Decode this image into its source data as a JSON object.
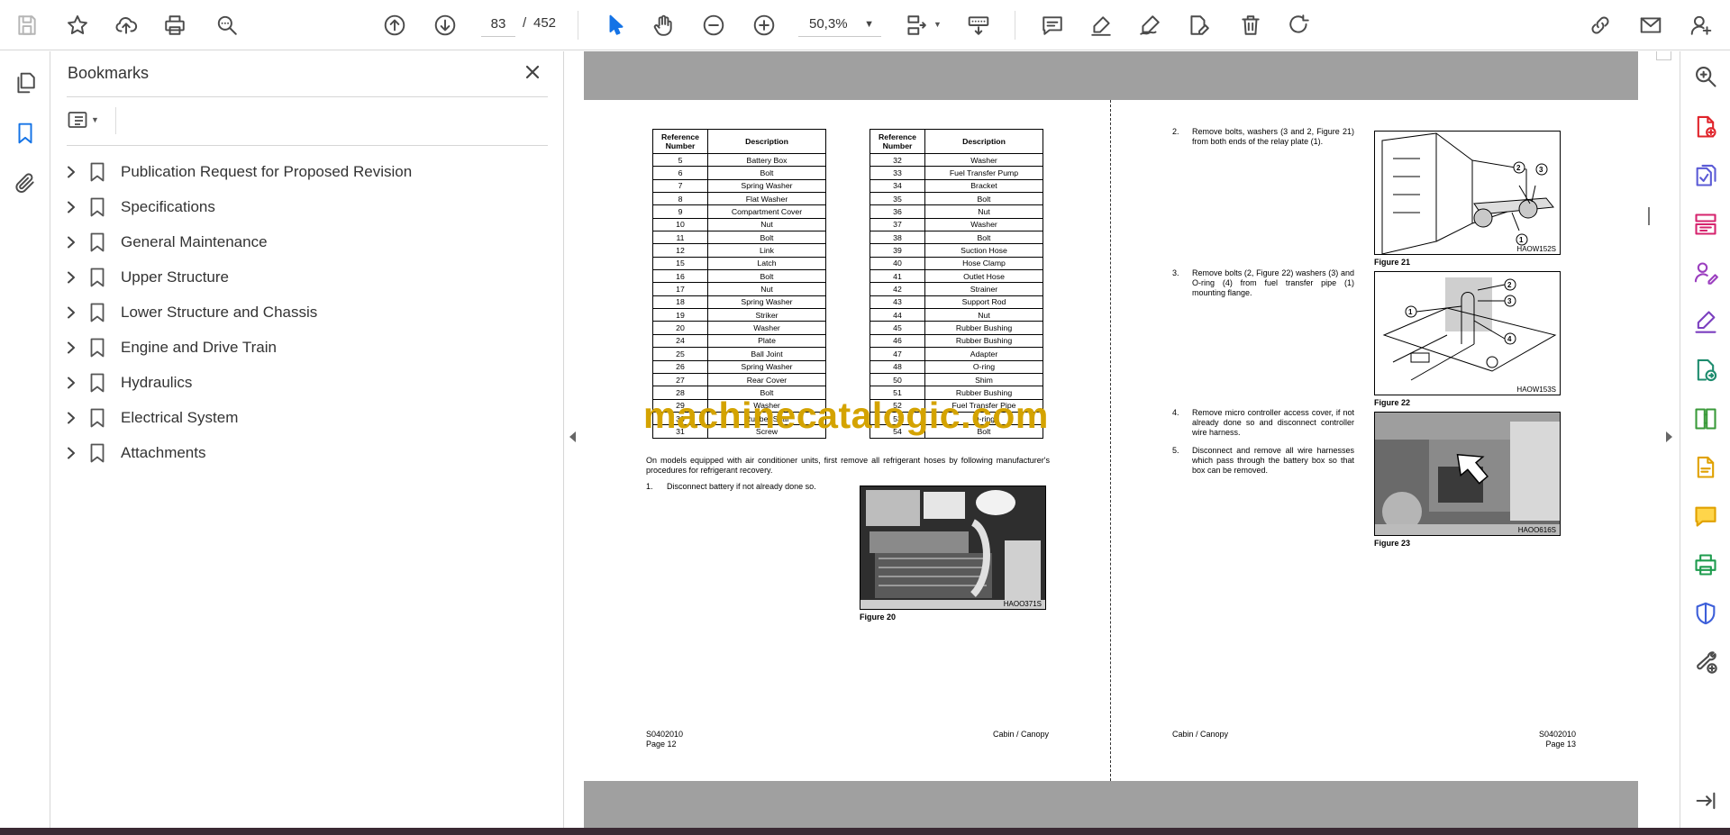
{
  "toolbar": {
    "current_page": "83",
    "page_separator": "/",
    "total_pages": "452",
    "zoom": "50,3%"
  },
  "bookmarks": {
    "title": "Bookmarks",
    "items": [
      {
        "label": "Publication Request for Proposed Revision"
      },
      {
        "label": "Specifications"
      },
      {
        "label": "General Maintenance"
      },
      {
        "label": "Upper Structure"
      },
      {
        "label": "Lower Structure and Chassis"
      },
      {
        "label": "Engine and Drive Train"
      },
      {
        "label": "Hydraulics"
      },
      {
        "label": "Electrical System"
      },
      {
        "label": "Attachments"
      }
    ]
  },
  "doc": {
    "table_headers": [
      "Reference Number",
      "Description"
    ],
    "table_left": [
      [
        "5",
        "Battery Box"
      ],
      [
        "6",
        "Bolt"
      ],
      [
        "7",
        "Spring Washer"
      ],
      [
        "8",
        "Flat Washer"
      ],
      [
        "9",
        "Compartment Cover"
      ],
      [
        "10",
        "Nut"
      ],
      [
        "11",
        "Bolt"
      ],
      [
        "12",
        "Link"
      ],
      [
        "15",
        "Latch"
      ],
      [
        "16",
        "Bolt"
      ],
      [
        "17",
        "Nut"
      ],
      [
        "18",
        "Spring Washer"
      ],
      [
        "19",
        "Striker"
      ],
      [
        "20",
        "Washer"
      ],
      [
        "24",
        "Plate"
      ],
      [
        "25",
        "Ball Joint"
      ],
      [
        "26",
        "Spring Washer"
      ],
      [
        "27",
        "Rear Cover"
      ],
      [
        "28",
        "Bolt"
      ],
      [
        "29",
        "Washer"
      ],
      [
        "30",
        "Rubber Seal"
      ],
      [
        "31",
        "Screw"
      ]
    ],
    "table_right": [
      [
        "32",
        "Washer"
      ],
      [
        "33",
        "Fuel Transfer Pump"
      ],
      [
        "34",
        "Bracket"
      ],
      [
        "35",
        "Bolt"
      ],
      [
        "36",
        "Nut"
      ],
      [
        "37",
        "Washer"
      ],
      [
        "38",
        "Bolt"
      ],
      [
        "39",
        "Suction Hose"
      ],
      [
        "40",
        "Hose Clamp"
      ],
      [
        "41",
        "Outlet Hose"
      ],
      [
        "42",
        "Strainer"
      ],
      [
        "43",
        "Support Rod"
      ],
      [
        "44",
        "Nut"
      ],
      [
        "45",
        "Rubber Bushing"
      ],
      [
        "46",
        "Rubber Bushing"
      ],
      [
        "47",
        "Adapter"
      ],
      [
        "48",
        "O-ring"
      ],
      [
        "50",
        "Shim"
      ],
      [
        "51",
        "Rubber Bushing"
      ],
      [
        "52",
        "Fuel Transfer Pipe"
      ],
      [
        "53",
        "O-ring"
      ],
      [
        "54",
        "Bolt"
      ]
    ],
    "intro": "On models equipped with air conditioner units, first remove all refrigerant hoses by following manufacturer's procedures for refrigerant recovery.",
    "step1_num": "1.",
    "step1": "Disconnect battery if not already done so.",
    "fig20_code": "HAOO371S",
    "fig20_caption": "Figure 20",
    "left_footer_code": "S0402010",
    "left_footer_page": "Page 12",
    "left_footer_title": "Cabin / Canopy",
    "step2_num": "2.",
    "step2": "Remove bolts, washers (3 and 2, Figure 21) from both ends of the relay plate (1).",
    "step3_num": "3.",
    "step3": "Remove bolts (2, Figure 22) washers (3) and O-ring (4) from fuel transfer pipe (1) mounting flange.",
    "step4_num": "4.",
    "step4": "Remove micro controller access cover, if not already done so and disconnect controller wire harness.",
    "step5_num": "5.",
    "step5": "Disconnect and remove all wire harnesses which pass through the battery box so that box can be removed.",
    "fig21_code": "HAOW152S",
    "fig21_caption": "Figure 21",
    "fig22_code": "HAOW153S",
    "fig22_caption": "Figure 22",
    "fig23_code": "HAOO616S",
    "fig23_caption": "Figure 23",
    "callouts": [
      "1",
      "2",
      "3",
      "4"
    ],
    "right_footer_title": "Cabin / Canopy",
    "right_footer_code": "S0402010",
    "right_footer_page": "Page 13"
  },
  "watermark": "machinecatalogic.com"
}
